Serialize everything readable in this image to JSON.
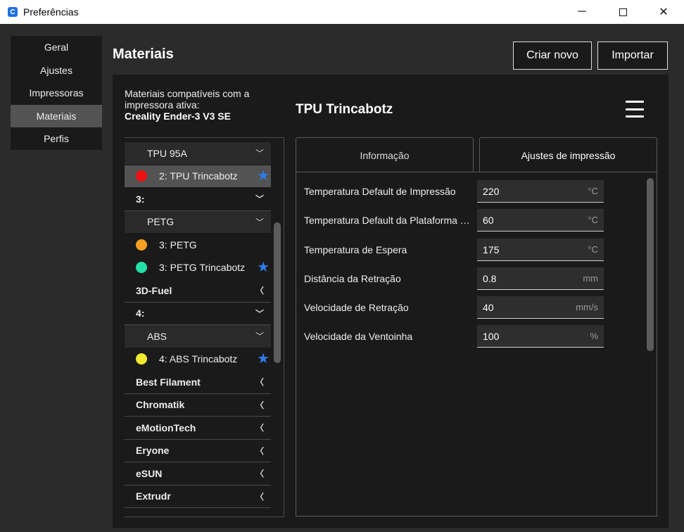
{
  "window": {
    "title": "Preferências",
    "logo_letter": "C",
    "minimize": "─",
    "close": "✕"
  },
  "sidebar": {
    "items": [
      {
        "label": "Geral"
      },
      {
        "label": "Ajustes"
      },
      {
        "label": "Impressoras"
      },
      {
        "label": "Materiais"
      },
      {
        "label": "Perfis"
      }
    ]
  },
  "header": {
    "title": "Materiais",
    "new_button": "Criar novo",
    "import_button": "Importar"
  },
  "compat": {
    "line": "Materiais compatíveis com a impressora ativa:",
    "printer": "Creality Ender-3 V3 SE"
  },
  "materials": {
    "rows": [
      {
        "type": "family",
        "label": "TPU 95A",
        "chevron": "﹀"
      },
      {
        "type": "material",
        "label": "2:  TPU Trincabotz",
        "color": "#ee1111",
        "favorite": "★",
        "selected": true
      },
      {
        "type": "brand",
        "label": "3:",
        "chevron": "﹀"
      },
      {
        "type": "family",
        "label": "PETG",
        "chevron": "﹀"
      },
      {
        "type": "material",
        "label": "3: PETG",
        "color": "#f5a020"
      },
      {
        "type": "material",
        "label": "3: PETG Trincabotz",
        "color": "#22e0a5",
        "favorite": "★"
      },
      {
        "type": "brand",
        "label": "3D-Fuel",
        "chevron": "〈"
      },
      {
        "type": "brand",
        "label": "4:",
        "chevron": "﹀"
      },
      {
        "type": "family",
        "label": "ABS",
        "chevron": "﹀"
      },
      {
        "type": "material",
        "label": "4: ABS Trincabotz",
        "color": "#f2ea30",
        "favorite": "★"
      },
      {
        "type": "brand",
        "label": "Best Filament",
        "chevron": "〈"
      },
      {
        "type": "brand",
        "label": "Chromatik",
        "chevron": "〈"
      },
      {
        "type": "brand",
        "label": "eMotionTech",
        "chevron": "〈"
      },
      {
        "type": "brand",
        "label": "Eryone",
        "chevron": "〈"
      },
      {
        "type": "brand",
        "label": "eSUN",
        "chevron": "〈"
      },
      {
        "type": "brand",
        "label": "Extrudr",
        "chevron": "〈"
      }
    ]
  },
  "detail": {
    "title": "TPU Trincabotz",
    "menu_icon": "hamburger-menu-icon",
    "tabs": [
      {
        "label": "Informação"
      },
      {
        "label": "Ajustes de impressão"
      }
    ],
    "settings": [
      {
        "label": "Temperatura Default de Impressão",
        "value": "220",
        "unit": "°C"
      },
      {
        "label": "Temperatura Default da Plataforma de Impressão",
        "value": "60",
        "unit": "°C"
      },
      {
        "label": "Temperatura de Espera",
        "value": "175",
        "unit": "°C"
      },
      {
        "label": "Distância da Retração",
        "value": "0.8",
        "unit": "mm"
      },
      {
        "label": "Velocidade de Retração",
        "value": "40",
        "unit": "mm/s"
      },
      {
        "label": "Velocidade da Ventoinha",
        "value": "100",
        "unit": "%"
      }
    ]
  }
}
